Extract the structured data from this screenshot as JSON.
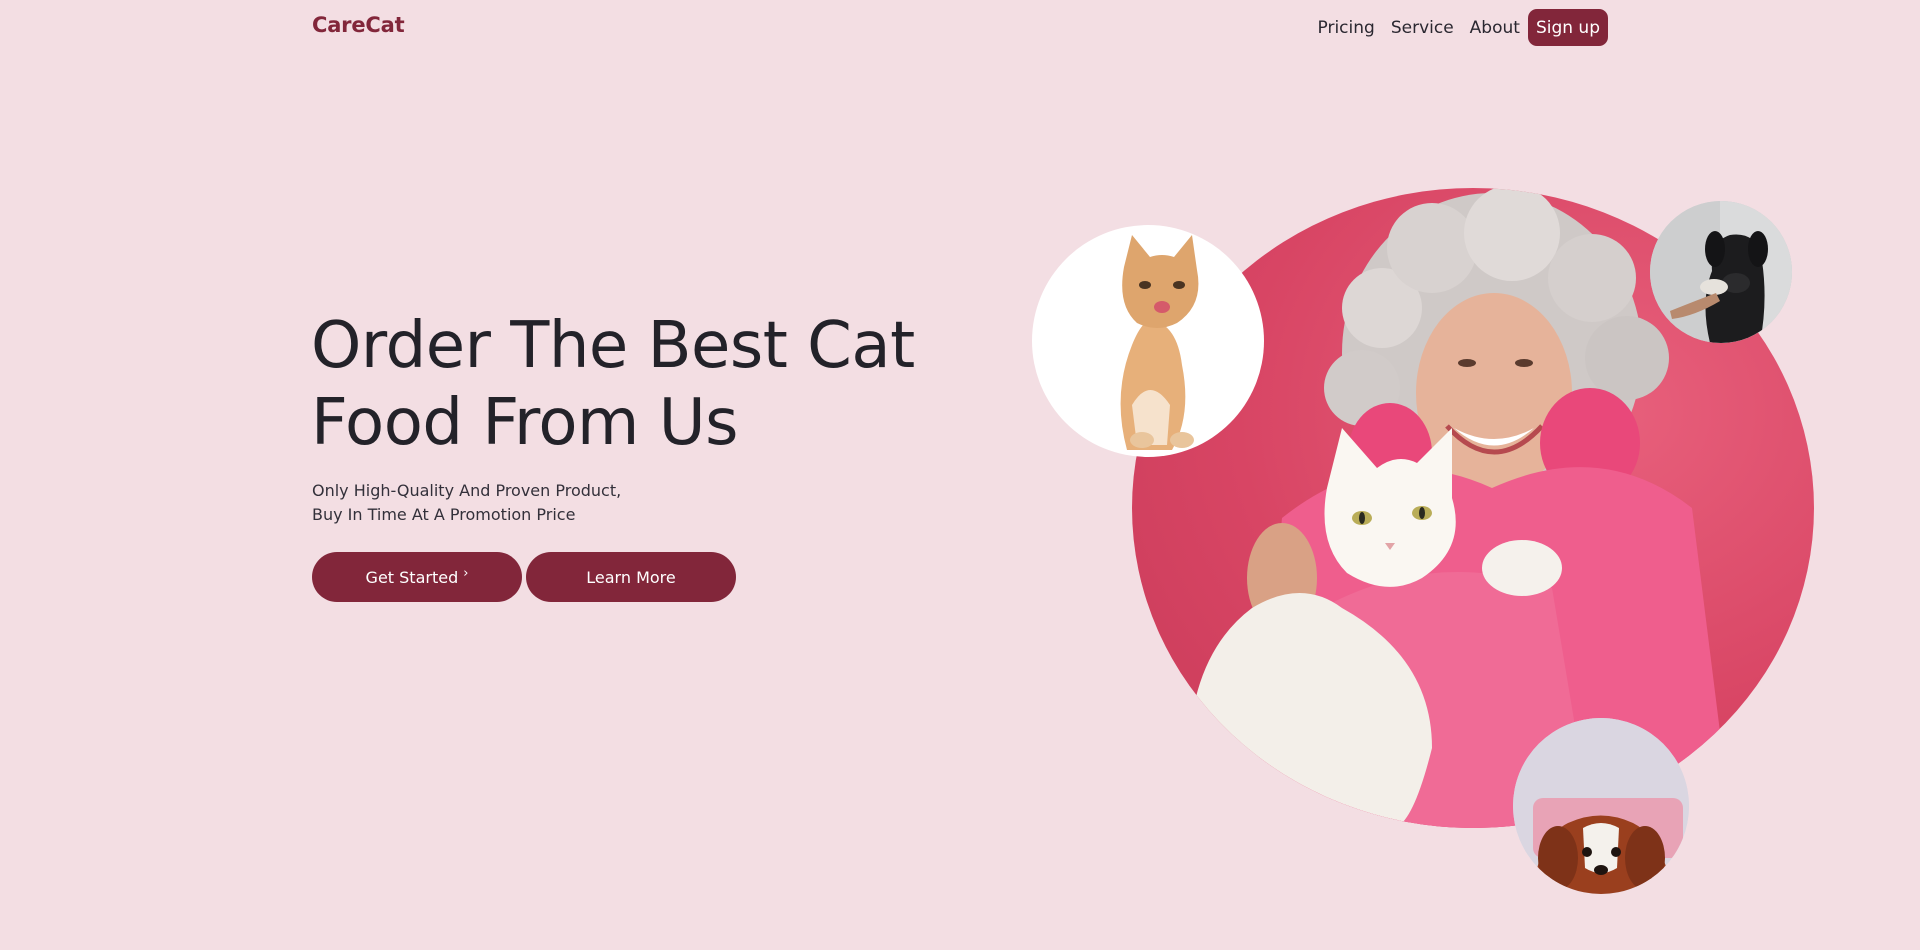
{
  "brand": {
    "name": "CareCat"
  },
  "nav": {
    "items": [
      {
        "label": "Pricing"
      },
      {
        "label": "Service"
      },
      {
        "label": "About"
      }
    ],
    "signup_label": "Sign up"
  },
  "hero": {
    "headline": "Order The Best Cat Food From Us",
    "subtitle_line1": "Only High-Quality And Proven Product,",
    "subtitle_line2": "Buy In Time At A Promotion Price",
    "primary_button": "Get Started",
    "primary_button_icon": "›",
    "secondary_button": "Learn More"
  },
  "colors": {
    "background": "#f3dee3",
    "accent": "#82263a",
    "circle": "#d84564"
  },
  "images": {
    "main": "woman-holding-white-cat-photo",
    "kitten": "orange-kitten-photo",
    "dog": "black-dog-photo",
    "puppy": "cavalier-puppy-photo"
  }
}
